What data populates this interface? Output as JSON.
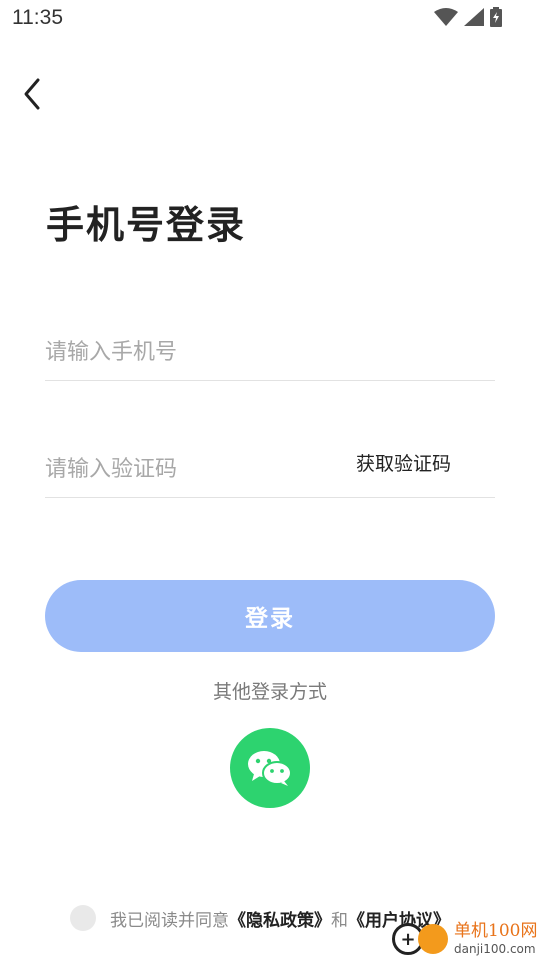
{
  "status_bar": {
    "time": "11:35"
  },
  "header": {
    "back_icon": "chevron-left-icon"
  },
  "title": "手机号登录",
  "phone": {
    "placeholder": "请输入手机号",
    "value": ""
  },
  "code": {
    "placeholder": "请输入验证码",
    "value": "",
    "get_code_label": "获取验证码"
  },
  "login_button": {
    "label": "登录"
  },
  "other_login": {
    "label": "其他登录方式",
    "wechat_icon": "wechat-icon"
  },
  "agreement": {
    "prefix": "我已阅读并同意",
    "privacy": "《隐私政策》",
    "and": "和",
    "terms": "《用户协议》"
  },
  "watermark": {
    "cn": "单机100网",
    "en": "danji100.com"
  },
  "colors": {
    "login_button": "#9dbcf9",
    "wechat": "#2dd36f",
    "placeholder": "#a8a8a8"
  }
}
